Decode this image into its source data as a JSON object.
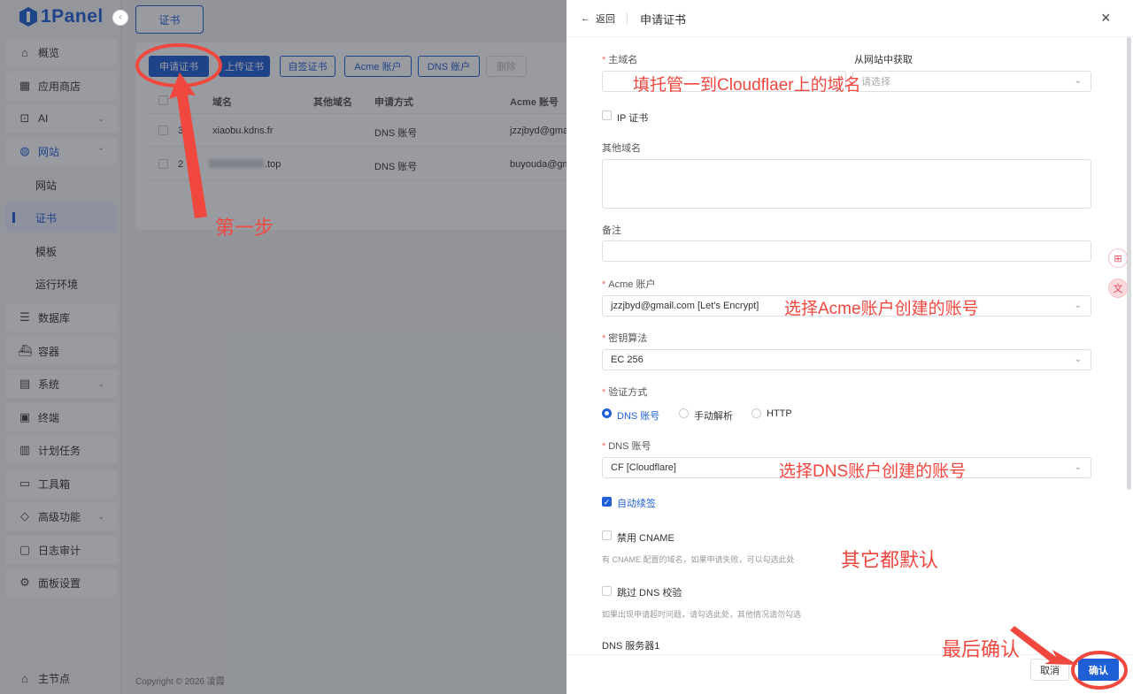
{
  "app": {
    "name": "1Panel"
  },
  "sidebar": {
    "items": [
      {
        "label": "概览",
        "icon": "home-icon"
      },
      {
        "label": "应用商店",
        "icon": "grid-icon"
      },
      {
        "label": "AI",
        "icon": "robot-icon",
        "expandable": true
      },
      {
        "label": "网站",
        "icon": "globe-icon",
        "expanded": true
      },
      {
        "label": "网站",
        "sub": true
      },
      {
        "label": "证书",
        "sub": true,
        "active": true
      },
      {
        "label": "模板",
        "sub": true
      },
      {
        "label": "运行环境",
        "sub": true
      },
      {
        "label": "数据库",
        "icon": "database-icon"
      },
      {
        "label": "容器",
        "icon": "container-icon"
      },
      {
        "label": "系统",
        "icon": "system-icon",
        "expandable": true
      },
      {
        "label": "终端",
        "icon": "terminal-icon"
      },
      {
        "label": "计划任务",
        "icon": "calendar-icon"
      },
      {
        "label": "工具箱",
        "icon": "toolbox-icon"
      },
      {
        "label": "高级功能",
        "icon": "diamond-icon",
        "expandable": true
      },
      {
        "label": "日志审计",
        "icon": "log-icon"
      },
      {
        "label": "面板设置",
        "icon": "settings-icon"
      }
    ],
    "bottom": {
      "label": "主节点",
      "icon": "node-icon"
    }
  },
  "main": {
    "tab": "证书",
    "toolbar": {
      "apply": "申请证书",
      "upload": "上传证书",
      "self_signed": "自签证书",
      "acme": "Acme 账户",
      "dns": "DNS 账户",
      "delete": "删除"
    },
    "table": {
      "headers": [
        "域名",
        "其他域名",
        "申请方式",
        "Acme 账号"
      ],
      "rows": [
        {
          "id": "3",
          "domain": "xiaobu.kdns.fr",
          "other": "",
          "method": "DNS 账号",
          "acme": "jzzjbyd@gma"
        },
        {
          "id": "2",
          "domain": ".top",
          "other": "",
          "method": "DNS 账号",
          "acme": "buyouda@gm"
        }
      ]
    },
    "footer": "Copyright © 2026 凌霞"
  },
  "drawer": {
    "back": "返回",
    "title": "申请证书",
    "primary_domain": {
      "label": "主域名",
      "value": "",
      "from_site_label": "从网站中获取",
      "from_site_placeholder": "请选择"
    },
    "ip_cert": {
      "label": "IP 证书",
      "checked": false
    },
    "other_domains": {
      "label": "其他域名",
      "value": ""
    },
    "remark": {
      "label": "备注",
      "value": ""
    },
    "acme_account": {
      "label": "Acme 账户",
      "value": "jzzjbyd@gmail.com [Let's Encrypt]"
    },
    "key_algo": {
      "label": "密钥算法",
      "value": "EC 256"
    },
    "verify": {
      "label": "验证方式",
      "options": [
        "DNS 账号",
        "手动解析",
        "HTTP"
      ],
      "selected": "DNS 账号"
    },
    "dns_account": {
      "label": "DNS 账号",
      "value": "CF [Cloudflare]"
    },
    "auto_renew": {
      "label": "自动续签",
      "checked": true
    },
    "disable_cname": {
      "label": "禁用 CNAME",
      "checked": false,
      "hint": "有 CNAME 配置的域名，如果申请失败，可以勾选此处"
    },
    "skip_dns": {
      "label": "跳过 DNS 校验",
      "checked": false,
      "hint": "如果出现申请超时问题，请勾选此处，其他情况请勿勾选"
    },
    "dns_server": {
      "label": "DNS 服务器1"
    },
    "cancel": "取消",
    "confirm": "确认"
  },
  "annotations": {
    "step1": "第一步",
    "domain_note": "填托管一到Cloudflaer上的域名",
    "acme_note": "选择Acme账户创建的账号",
    "dns_note": "选择DNS账户创建的账号",
    "default_note": "其它都默认",
    "final_note": "最后确认"
  },
  "colors": {
    "primary": "#1f5fd6",
    "annotation": "#f0473e",
    "required": "#f56c6c"
  }
}
